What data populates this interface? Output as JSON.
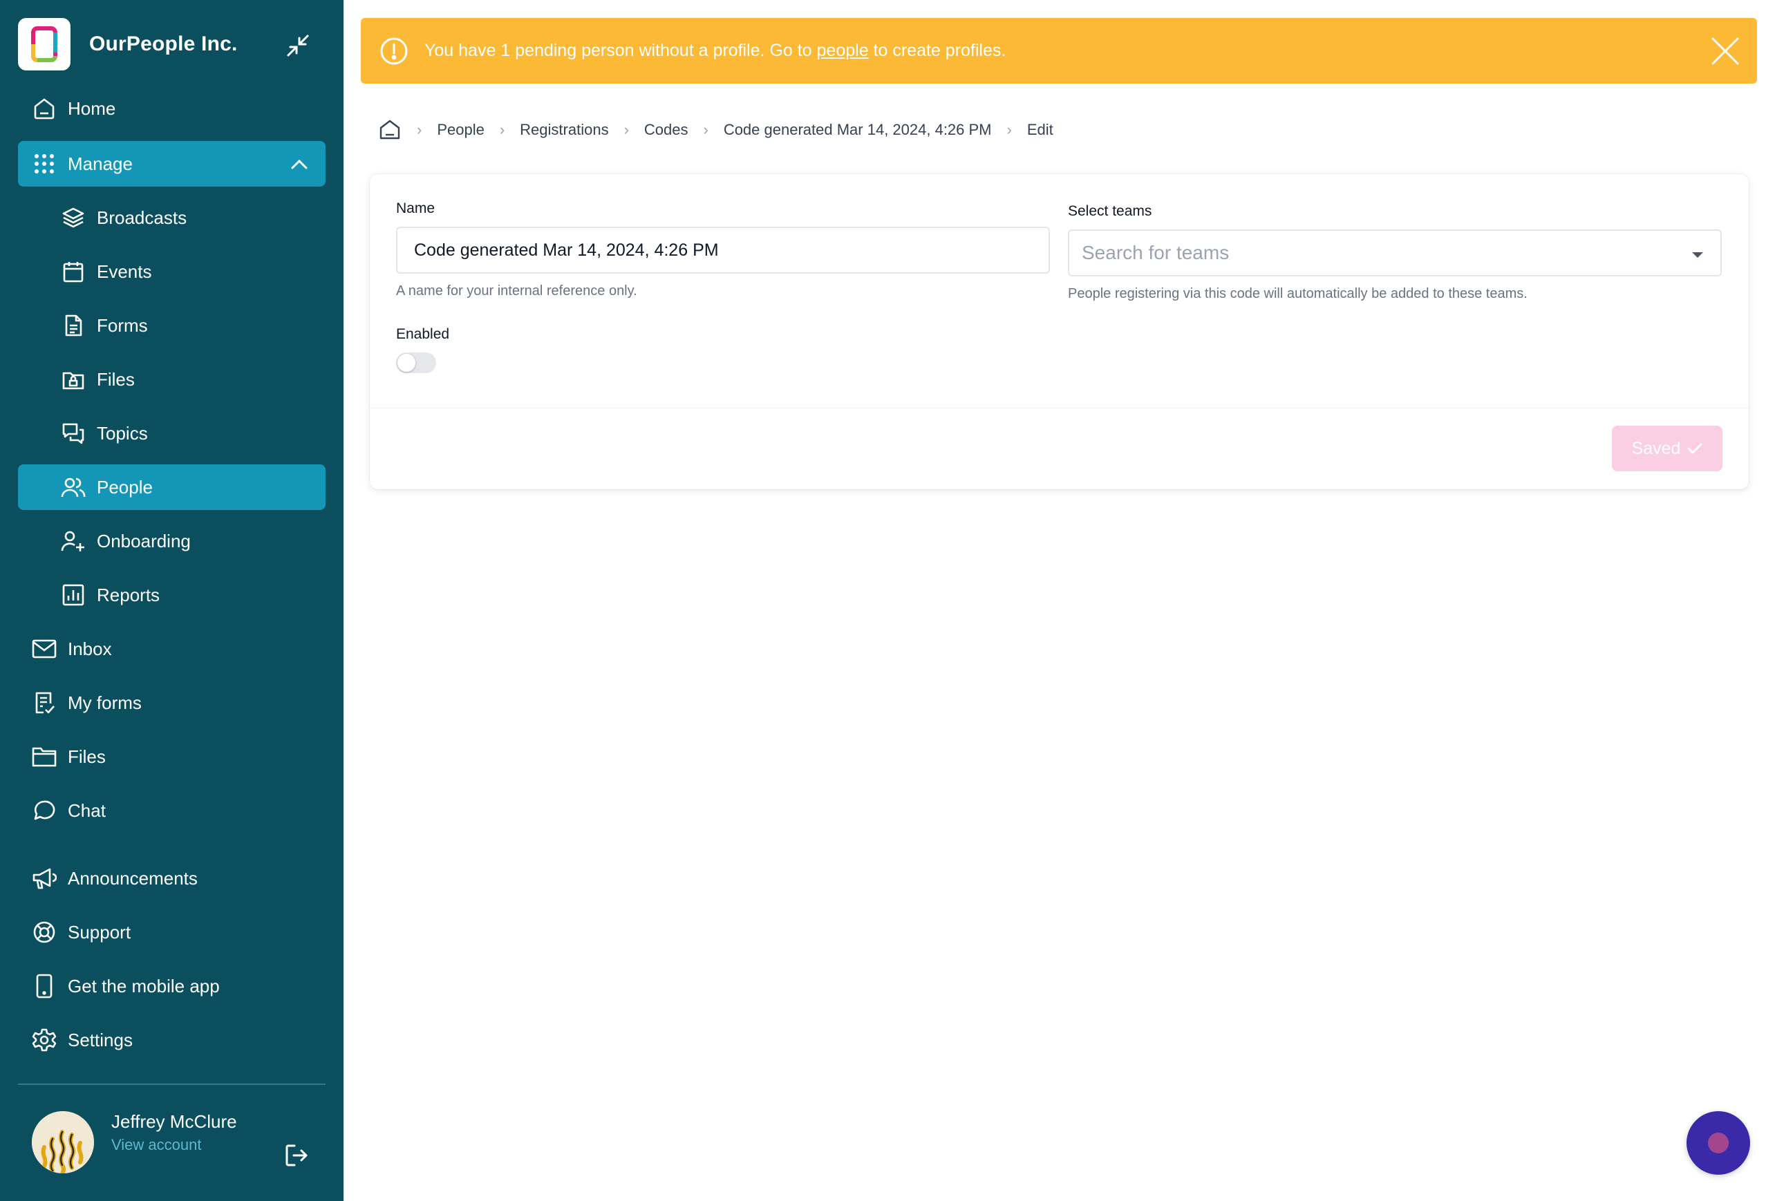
{
  "brand": {
    "name": "OurPeople Inc."
  },
  "nav": {
    "home": "Home",
    "manage": "Manage",
    "broadcasts": "Broadcasts",
    "events": "Events",
    "forms": "Forms",
    "files_sub": "Files",
    "topics": "Topics",
    "people": "People",
    "onboarding": "Onboarding",
    "reports": "Reports",
    "inbox": "Inbox",
    "my_forms": "My forms",
    "files": "Files",
    "chat": "Chat",
    "announcements": "Announcements",
    "support": "Support",
    "mobile_app": "Get the mobile app",
    "settings": "Settings"
  },
  "account": {
    "name": "Jeffrey McClure",
    "link": "View account"
  },
  "banner": {
    "prefix": "You have 1 pending person without a profile. Go to ",
    "link": "people",
    "suffix": " to create profiles."
  },
  "breadcrumb": [
    "People",
    "Registrations",
    "Codes",
    "Code generated Mar 14, 2024, 4:26 PM",
    "Edit"
  ],
  "form": {
    "name_label": "Name",
    "name_value": "Code generated Mar 14, 2024, 4:26 PM",
    "name_hint": "A name for your internal reference only.",
    "enabled_label": "Enabled",
    "enabled": false,
    "teams_label": "Select teams",
    "teams_placeholder": "Search for teams",
    "teams_hint": "People registering via this code will automatically be added to these teams.",
    "save_label": "Saved"
  },
  "colors": {
    "sidebar": "#0b4f5f",
    "active": "#1497b6",
    "banner": "#fcb935",
    "saved_button": "#fbcfe3",
    "fab": "#3b2aa8"
  }
}
